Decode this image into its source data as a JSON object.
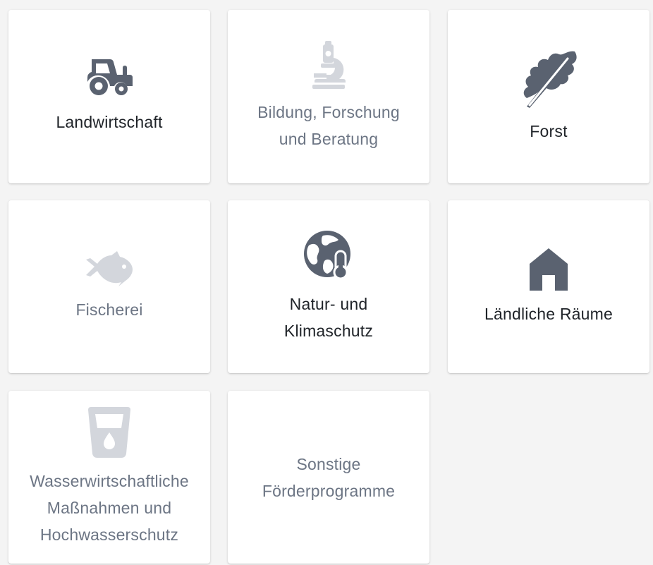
{
  "colors": {
    "background": "#f4f4f4",
    "card": "#ffffff",
    "icon_active": "#5a6270",
    "icon_muted": "#d3d6dc",
    "text_active": "#1f2328",
    "text_muted": "#6c7584"
  },
  "tiles": [
    {
      "icon": "tractor-icon",
      "active": true,
      "label_lines": [
        "Landwirtschaft"
      ]
    },
    {
      "icon": "microscope-icon",
      "active": false,
      "label_lines": [
        "Bildung, Forschung",
        "und Beratung"
      ]
    },
    {
      "icon": "leaf-icon",
      "active": true,
      "label_lines": [
        "Forst"
      ]
    },
    {
      "icon": "fish-icon",
      "active": false,
      "label_lines": [
        "Fischerei"
      ]
    },
    {
      "icon": "globe-thermometer-icon",
      "active": true,
      "label_lines": [
        "Natur- und",
        "Klimaschutz"
      ]
    },
    {
      "icon": "house-icon",
      "active": true,
      "label_lines": [
        "Ländliche Räume"
      ]
    },
    {
      "icon": "water-glass-icon",
      "active": false,
      "label_lines": [
        "Wasserwirtschaftliche",
        "Maßnahmen und",
        "Hochwasserschutz"
      ]
    },
    {
      "icon": "",
      "active": false,
      "label_lines": [
        "Sonstige",
        "Förderprogramme"
      ]
    }
  ]
}
